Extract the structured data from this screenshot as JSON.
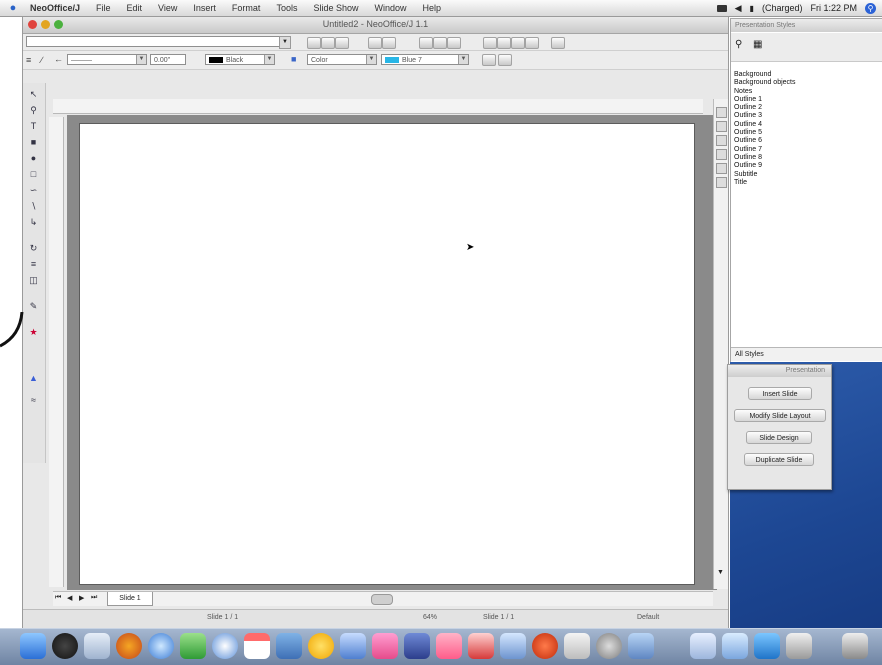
{
  "menubar": {
    "app_name": "NeoOffice/J",
    "items": [
      "File",
      "Edit",
      "View",
      "Insert",
      "Format",
      "Tools",
      "Slide Show",
      "Window",
      "Help"
    ],
    "battery": "(Charged)",
    "clock": "Fri 1:22 PM"
  },
  "window": {
    "title": "Untitled2 - NeoOffice/J 1.1",
    "line_width": "0.00\"",
    "line_style": "———",
    "line_color": "Black",
    "area_style": "Color",
    "area_color": "Blue 7"
  },
  "slide_tab": {
    "label": "Slide 1"
  },
  "status": {
    "left": "Slide 1 / 1",
    "zoom": "64%",
    "slide_info": "Slide 1 / 1",
    "layout": "Default"
  },
  "stylist": {
    "title": "Presentation Styles",
    "styles": [
      "Background",
      "Background objects",
      "Notes",
      "Outline 1",
      "Outline 2",
      "Outline 3",
      "Outline 4",
      "Outline 5",
      "Outline 6",
      "Outline 7",
      "Outline 8",
      "Outline 9",
      "Subtitle",
      "Title"
    ],
    "filter": "All Styles"
  },
  "presentation": {
    "title": "Presentation",
    "buttons": [
      "Insert Slide",
      "Modify Slide Layout",
      "Slide Design",
      "Duplicate Slide"
    ]
  },
  "colors": {
    "desktop": "#1f4a96",
    "accent": "#2c63d6"
  }
}
